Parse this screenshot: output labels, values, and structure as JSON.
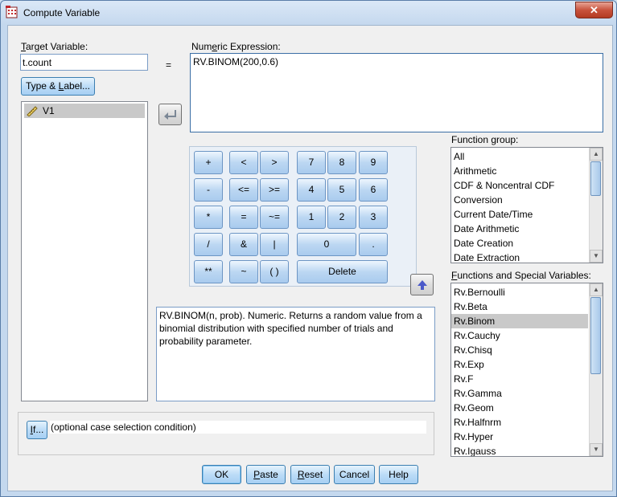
{
  "window": {
    "title": "Compute Variable",
    "close_label": "✕"
  },
  "target": {
    "label_pre": "",
    "label_u": "T",
    "label_post": "arget Variable:",
    "value": "t.count"
  },
  "equals": "=",
  "type_label_btn": {
    "pre": "Type & ",
    "u": "L",
    "post": "abel..."
  },
  "variables": [
    {
      "name": "V1",
      "selected": true
    }
  ],
  "expression": {
    "label_pre": "Num",
    "label_u": "e",
    "label_post": "ric Expression:",
    "value": "RV.BINOM(200,0.6)"
  },
  "calc": {
    "ops": [
      "+",
      "<",
      ">",
      "-",
      "<=",
      ">=",
      "*",
      "=",
      "~=",
      "/",
      "&",
      "|",
      "**",
      "~",
      "( )"
    ],
    "digits": [
      "7",
      "8",
      "9",
      "4",
      "5",
      "6",
      "1",
      "2",
      "3",
      "0",
      "."
    ],
    "delete": "Delete"
  },
  "description": "RV.BINOM(n, prob). Numeric. Returns a random value from a binomial distribution with specified number of trials and probability parameter.",
  "function_group": {
    "label": "Function group:",
    "items": [
      "All",
      "Arithmetic",
      "CDF & Noncentral CDF",
      "Conversion",
      "Current Date/Time",
      "Date Arithmetic",
      "Date Creation",
      "Date Extraction"
    ]
  },
  "functions": {
    "label_pre": "",
    "label_u": "F",
    "label_post": "unctions and Special Variables:",
    "items": [
      "Rv.Bernoulli",
      "Rv.Beta",
      "Rv.Binom",
      "Rv.Cauchy",
      "Rv.Chisq",
      "Rv.Exp",
      "Rv.F",
      "Rv.Gamma",
      "Rv.Geom",
      "Rv.Halfnrm",
      "Rv.Hyper",
      "Rv.Igauss"
    ],
    "selected": "Rv.Binom"
  },
  "if_btn": {
    "u": "I",
    "post": "f..."
  },
  "condition": "(optional case selection condition)",
  "buttons": {
    "ok": "OK",
    "paste": {
      "u": "P",
      "post": "aste"
    },
    "reset": {
      "u": "R",
      "post": "eset"
    },
    "cancel": "Cancel",
    "help": "Help"
  }
}
